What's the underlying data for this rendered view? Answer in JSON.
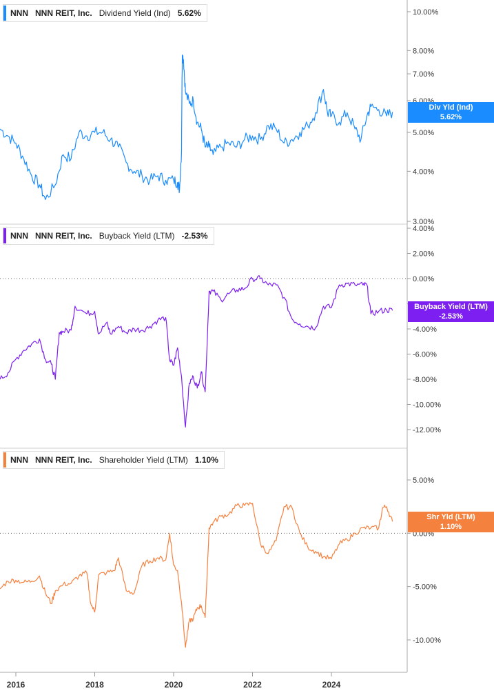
{
  "panels": [
    {
      "ticker": "NNN",
      "company": "NNN REIT, Inc.",
      "metric": "Dividend Yield (Ind)",
      "value": "5.62%",
      "color": "#1a8cff",
      "badge_line1": "Div Yld (Ind)",
      "badge_line2": "5.62%"
    },
    {
      "ticker": "NNN",
      "company": "NNN REIT, Inc.",
      "metric": "Buyback Yield (LTM)",
      "value": "-2.53%",
      "color": "#7c1ff0",
      "badge_line1": "Buyback Yield (LTM)",
      "badge_line2": "-2.53%"
    },
    {
      "ticker": "NNN",
      "company": "NNN REIT, Inc.",
      "metric": "Shareholder Yield (LTM)",
      "value": "1.10%",
      "color": "#f5813f",
      "badge_line1": "Shr Yld (LTM)",
      "badge_line2": "1.10%"
    }
  ],
  "x_ticks": [
    "2016",
    "2018",
    "2020",
    "2022",
    "2024"
  ],
  "chart_data": [
    {
      "type": "line",
      "scale": "log",
      "series": [
        {
          "name": "Dividend Yield (Ind)",
          "x": [
            2015.6,
            2015.8,
            2016.0,
            2016.2,
            2016.4,
            2016.6,
            2016.75,
            2017.0,
            2017.2,
            2017.4,
            2017.6,
            2017.8,
            2018.0,
            2018.2,
            2018.4,
            2018.6,
            2018.8,
            2019.0,
            2019.2,
            2019.4,
            2019.6,
            2019.8,
            2020.0,
            2020.1,
            2020.15,
            2020.2,
            2020.22,
            2020.25,
            2020.3,
            2020.4,
            2020.5,
            2020.6,
            2020.7,
            2020.8,
            2020.9,
            2021.0,
            2021.2,
            2021.4,
            2021.6,
            2021.8,
            2022.0,
            2022.2,
            2022.4,
            2022.6,
            2022.8,
            2023.0,
            2023.2,
            2023.4,
            2023.6,
            2023.8,
            2023.9,
            2024.0,
            2024.2,
            2024.4,
            2024.6,
            2024.75,
            2024.9,
            2025.0,
            2025.2,
            2025.4,
            2025.55
          ],
          "values": [
            5.1,
            4.9,
            4.7,
            4.3,
            3.9,
            3.7,
            3.4,
            3.7,
            4.4,
            4.3,
            5.0,
            4.9,
            5.0,
            5.0,
            4.8,
            4.6,
            4.2,
            4.0,
            3.9,
            3.8,
            3.9,
            3.8,
            3.8,
            3.75,
            3.6,
            4.5,
            7.8,
            7.6,
            6.3,
            5.9,
            6.0,
            5.3,
            5.1,
            4.6,
            4.6,
            4.4,
            4.6,
            4.7,
            4.6,
            4.8,
            4.9,
            4.8,
            5.2,
            5.1,
            4.7,
            4.8,
            5.0,
            5.2,
            5.6,
            6.4,
            5.6,
            5.5,
            5.3,
            5.6,
            5.1,
            4.8,
            5.5,
            5.8,
            5.7,
            5.5,
            5.62
          ]
        }
      ],
      "ylim": [
        3.0,
        10.0
      ],
      "y_ticks": [
        "10.00%",
        "8.00%",
        "7.00%",
        "6.00%",
        "5.00%",
        "4.00%",
        "3.00%"
      ]
    },
    {
      "type": "line",
      "series": [
        {
          "name": "Buyback Yield (LTM)",
          "x": [
            2015.6,
            2015.8,
            2016.0,
            2016.2,
            2016.4,
            2016.6,
            2016.75,
            2016.9,
            2017.0,
            2017.1,
            2017.2,
            2017.4,
            2017.5,
            2017.8,
            2018.0,
            2018.1,
            2018.3,
            2018.4,
            2018.6,
            2018.8,
            2019.0,
            2019.2,
            2019.4,
            2019.6,
            2019.8,
            2019.9,
            2020.0,
            2020.1,
            2020.2,
            2020.3,
            2020.4,
            2020.5,
            2020.6,
            2020.7,
            2020.8,
            2020.9,
            2021.0,
            2021.2,
            2021.4,
            2021.6,
            2021.8,
            2022.0,
            2022.2,
            2022.4,
            2022.6,
            2022.8,
            2023.0,
            2023.2,
            2023.4,
            2023.6,
            2023.8,
            2024.0,
            2024.2,
            2024.4,
            2024.6,
            2024.8,
            2024.9,
            2025.0,
            2025.2,
            2025.4,
            2025.55
          ],
          "values": [
            -8.0,
            -7.5,
            -6.4,
            -5.7,
            -5.2,
            -4.8,
            -6.4,
            -6.8,
            -8.0,
            -4.3,
            -4.2,
            -4.1,
            -2.2,
            -2.8,
            -2.6,
            -4.4,
            -3.5,
            -4.4,
            -3.8,
            -4.3,
            -4.0,
            -4.1,
            -3.8,
            -3.3,
            -3.1,
            -6.5,
            -6.9,
            -5.5,
            -7.8,
            -11.8,
            -8.3,
            -7.8,
            -8.7,
            -7.4,
            -9.0,
            -1.0,
            -1.0,
            -1.7,
            -1.2,
            -0.9,
            -0.8,
            0.0,
            0.0,
            -0.5,
            -0.5,
            -1.5,
            -3.2,
            -3.6,
            -3.8,
            -3.9,
            -2.2,
            -2.3,
            -0.5,
            -0.4,
            -0.5,
            -0.5,
            -0.5,
            -2.8,
            -2.6,
            -2.5,
            -2.53
          ]
        }
      ],
      "ylim": [
        -12.0,
        4.0
      ],
      "y_ticks": [
        "4.00%",
        "2.00%",
        "0.00%",
        "-2.00%",
        "-4.00%",
        "-6.00%",
        "-8.00%",
        "-10.00%",
        "-12.00%"
      ]
    },
    {
      "type": "line",
      "series": [
        {
          "name": "Shareholder Yield (LTM)",
          "x": [
            2015.6,
            2015.8,
            2016.0,
            2016.2,
            2016.4,
            2016.6,
            2016.75,
            2016.9,
            2017.0,
            2017.2,
            2017.4,
            2017.6,
            2017.8,
            2017.9,
            2018.0,
            2018.1,
            2018.3,
            2018.5,
            2018.6,
            2018.8,
            2019.0,
            2019.2,
            2019.4,
            2019.6,
            2019.8,
            2019.9,
            2020.0,
            2020.1,
            2020.2,
            2020.3,
            2020.4,
            2020.5,
            2020.6,
            2020.7,
            2020.8,
            2020.9,
            2021.0,
            2021.2,
            2021.4,
            2021.6,
            2021.8,
            2022.0,
            2022.2,
            2022.4,
            2022.6,
            2022.8,
            2023.0,
            2023.2,
            2023.4,
            2023.6,
            2023.8,
            2024.0,
            2024.2,
            2024.4,
            2024.6,
            2024.8,
            2025.0,
            2025.2,
            2025.3,
            2025.4,
            2025.55
          ],
          "values": [
            -5.2,
            -4.5,
            -4.4,
            -4.6,
            -4.5,
            -4.0,
            -5.6,
            -6.6,
            -5.4,
            -4.8,
            -4.7,
            -4.0,
            -3.7,
            -6.6,
            -7.4,
            -3.9,
            -3.7,
            -3.5,
            -2.3,
            -5.4,
            -5.6,
            -3.0,
            -2.6,
            -2.3,
            -2.5,
            0.0,
            -3.0,
            -3.5,
            -6.5,
            -10.7,
            -8.2,
            -8.0,
            -7.0,
            -6.8,
            -7.9,
            0.5,
            1.0,
            1.6,
            1.8,
            2.6,
            2.6,
            2.8,
            -1.0,
            -1.9,
            -0.7,
            2.5,
            2.4,
            0.0,
            -1.3,
            -1.7,
            -2.2,
            -2.4,
            -1.0,
            -0.6,
            0.0,
            0.5,
            0.5,
            0.5,
            2.4,
            2.5,
            1.1
          ]
        }
      ],
      "ylim": [
        -11.0,
        6.0
      ],
      "y_ticks": [
        "5.00%",
        "0.00%",
        "-5.00%",
        "-10.00%"
      ]
    }
  ]
}
